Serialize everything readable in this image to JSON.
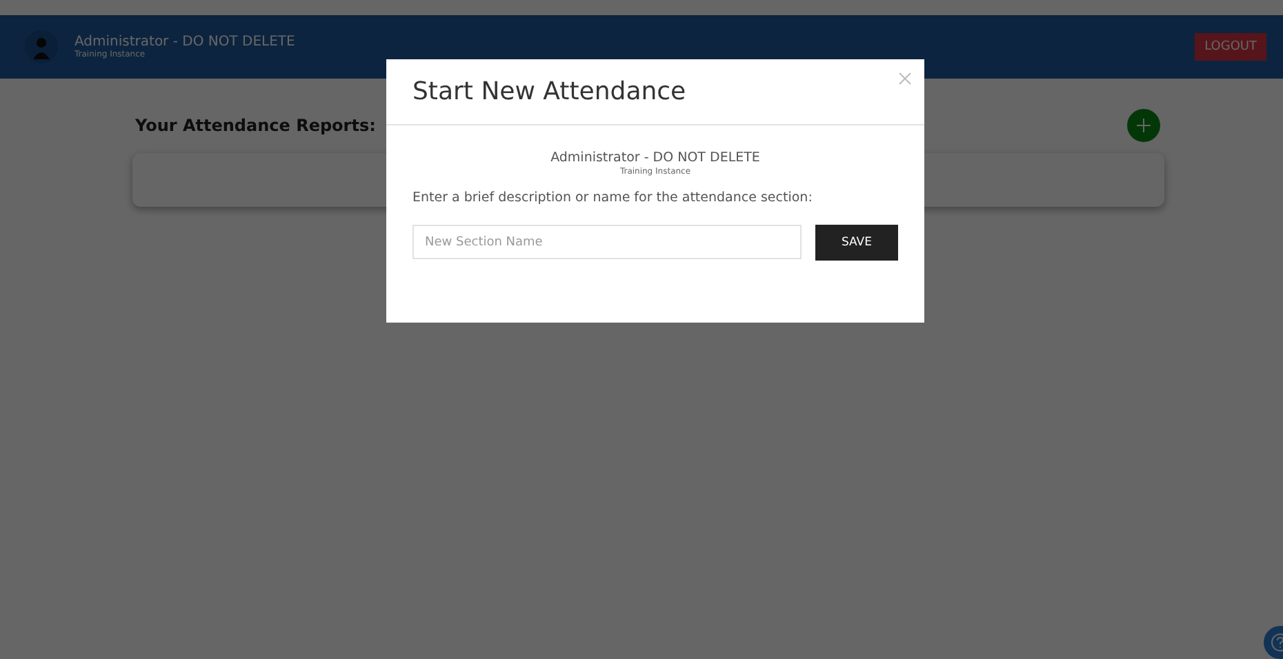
{
  "header": {
    "user_name": "Administrator - DO NOT DELETE",
    "instance": "Training Instance",
    "logout_label": "LOGOUT"
  },
  "page": {
    "title": "Your Attendance Reports:"
  },
  "modal": {
    "title": "Start New Attendance",
    "user_name": "Administrator - DO NOT DELETE",
    "instance": "Training Instance",
    "prompt": "Enter a brief description or name for the attendance section:",
    "input": {
      "placeholder": "New Section Name"
    },
    "save_label": "SAVE"
  }
}
